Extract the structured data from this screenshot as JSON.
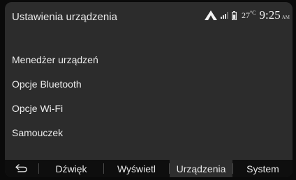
{
  "header": {
    "title": "Ustawienia urządzenia",
    "temperature": "27",
    "temperature_unit": "°C",
    "time": "9:25",
    "ampm": "AM",
    "icons": [
      "android-auto-icon",
      "signal-icon",
      "battery-icon"
    ]
  },
  "menu": {
    "items": [
      {
        "label": "Menedżer urządzeń"
      },
      {
        "label": "Opcje Bluetooth"
      },
      {
        "label": "Opcje Wi-Fi"
      },
      {
        "label": "Samouczek"
      }
    ]
  },
  "tabbar": {
    "back_icon": "back-arrow-icon",
    "tabs": [
      {
        "label": "Dźwięk",
        "active": false
      },
      {
        "label": "Wyświetl",
        "active": false
      },
      {
        "label": "Urządzenia",
        "active": true
      },
      {
        "label": "System",
        "active": false
      }
    ]
  },
  "colors": {
    "screen_background": "#2c2c2c",
    "tabbar_background": "#0e0e0e",
    "active_tab_background": "#2e2e2e",
    "text": "#ececec"
  }
}
